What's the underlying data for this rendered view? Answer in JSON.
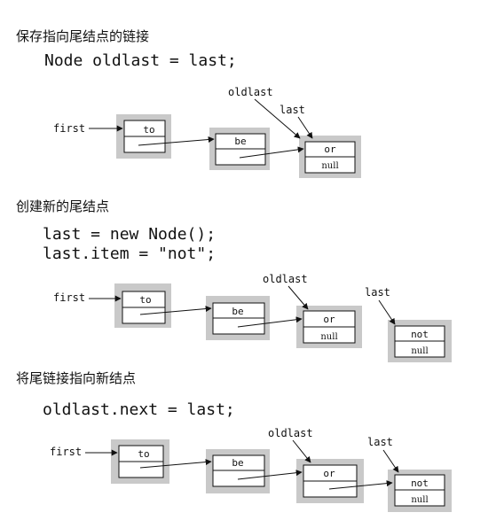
{
  "steps": [
    {
      "heading": "保存指向尾结点的链接",
      "code": [
        "Node oldlast = last;"
      ],
      "diagram": {
        "pointers": {
          "first": "first",
          "oldlast": "oldlast",
          "last": "last"
        },
        "nodes": [
          {
            "item": "to",
            "next": ""
          },
          {
            "item": "be",
            "next": ""
          },
          {
            "item": "or",
            "next": "null"
          }
        ]
      }
    },
    {
      "heading": "创建新的尾结点",
      "code": [
        "last = new Node();",
        "last.item = \"not\";"
      ],
      "diagram": {
        "pointers": {
          "first": "first",
          "oldlast": "oldlast",
          "last": "last"
        },
        "nodes": [
          {
            "item": "to",
            "next": ""
          },
          {
            "item": "be",
            "next": ""
          },
          {
            "item": "or",
            "next": "null"
          },
          {
            "item": "not",
            "next": "null"
          }
        ]
      }
    },
    {
      "heading": "将尾链接指向新结点",
      "code": [
        "oldlast.next = last;"
      ],
      "diagram": {
        "pointers": {
          "first": "first",
          "oldlast": "oldlast",
          "last": "last"
        },
        "nodes": [
          {
            "item": "to",
            "next": ""
          },
          {
            "item": "be",
            "next": ""
          },
          {
            "item": "or",
            "next": ""
          },
          {
            "item": "not",
            "next": "null"
          }
        ]
      }
    }
  ],
  "colors": {
    "node_shadow": "#c9c9c9",
    "stroke": "#111111"
  }
}
